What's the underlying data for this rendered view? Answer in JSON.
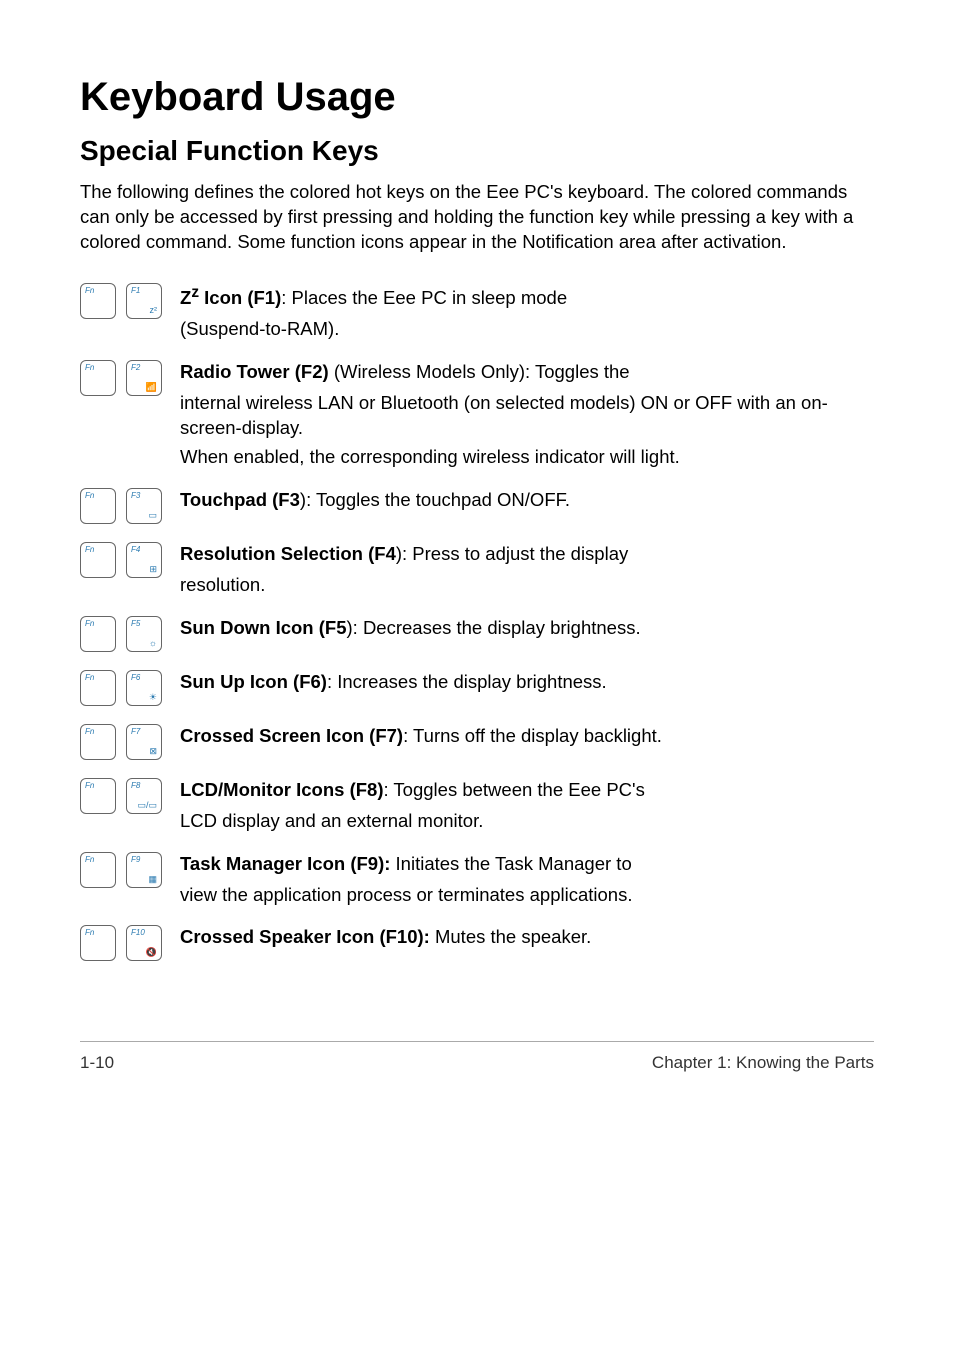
{
  "heading": "Keyboard Usage",
  "subheading": "Special Function Keys",
  "intro": "The following defines the colored hot keys on the Eee PC's keyboard. The colored commands can only be accessed by first pressing and holding the function key while pressing a key with a colored command. Some function icons appear in the Notification area after activation.",
  "fn_label": "Fn",
  "keys": [
    {
      "key_label": "F1",
      "icon": "z²",
      "title_html": "<b>Z<sup>z</sup> Icon (F1)</b>: Places the Eee PC in sleep mode",
      "line2": "(Suspend-to-RAM)."
    },
    {
      "key_label": "F2",
      "icon": "📶",
      "title_html": "<b>Radio Tower (F2)</b> (Wireless Models Only): Toggles the",
      "line2": "internal wireless LAN or Bluetooth (on selected models) ON or OFF with an on-screen-display.",
      "line3": "When enabled, the corresponding wireless indicator will light."
    },
    {
      "key_label": "F3",
      "icon": "▭",
      "title_html": "<b>Touchpad (F3</b>): Toggles the touchpad ON/OFF."
    },
    {
      "key_label": "F4",
      "icon": "⊞",
      "title_html": "<b>Resolution Selection (F4</b>): Press to adjust the display",
      "line2": "resolution."
    },
    {
      "key_label": "F5",
      "icon": "☼",
      "title_html": "<b>Sun Down Icon (F5</b>): Decreases the display brightness."
    },
    {
      "key_label": "F6",
      "icon": "☀",
      "title_html": "<b>Sun Up Icon (F6)</b>: Increases the display brightness."
    },
    {
      "key_label": "F7",
      "icon": "⊠",
      "title_html": "<b>Crossed Screen Icon (F7)</b>: Turns off the display backlight."
    },
    {
      "key_label": "F8",
      "icon": "▭/▭",
      "title_html": "<b>LCD/Monitor Icons (F8)</b>: Toggles between the Eee PC's",
      "line2": "LCD display and an external monitor."
    },
    {
      "key_label": "F9",
      "icon": "▦",
      "title_html": "<b>Task Manager Icon (F9):</b> Initiates the Task Manager to",
      "line2": "view the application process or terminates applications."
    },
    {
      "key_label": "F10",
      "icon": "🔇",
      "title_html": "<b>Crossed Speaker Icon (F10):</b> Mutes the speaker."
    }
  ],
  "footer_left": "1-10",
  "footer_right": "Chapter 1: Knowing the Parts"
}
